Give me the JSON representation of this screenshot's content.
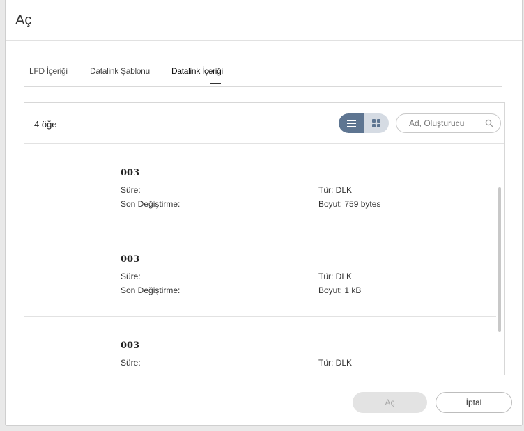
{
  "dialog": {
    "title": "Aç"
  },
  "tabs": [
    {
      "label": "LFD İçeriği"
    },
    {
      "label": "Datalink Şablonu"
    },
    {
      "label": "Datalink İçeriği",
      "active": true
    }
  ],
  "panel": {
    "count": "4 öğe",
    "view_mode": "list",
    "search": {
      "placeholder": "Ad, Oluşturucu",
      "value": ""
    }
  },
  "items": [
    {
      "name": "003",
      "duration_label": "Süre:",
      "modified_label": "Son Değiştirme:",
      "type": "Tür: DLK",
      "size": "Boyut: 759 bytes"
    },
    {
      "name": "003",
      "duration_label": "Süre:",
      "modified_label": "Son Değiştirme:",
      "type": "Tür: DLK",
      "size": "Boyut: 1 kB"
    },
    {
      "name": "003",
      "duration_label": "Süre:",
      "modified_label": "",
      "type": "Tür: DLK",
      "size": ""
    }
  ],
  "footer": {
    "open_label": "Aç",
    "cancel_label": "İptal"
  },
  "colors": {
    "accent": "#5e7591",
    "toggle_bg": "#d5dbe3"
  }
}
